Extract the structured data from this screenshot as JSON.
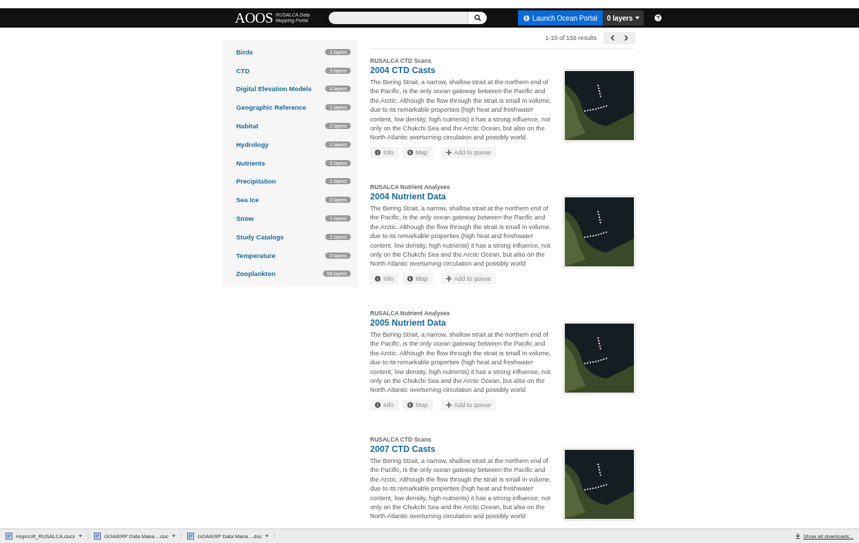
{
  "navbar": {
    "logo": "AOOS",
    "subtitle_1": "RUSALCA Data",
    "subtitle_2": "Mapping Portal",
    "launch_button": "Launch Ocean Portal",
    "layers_button": "0 layers"
  },
  "pagination": {
    "summary": "1-10 of 156 results"
  },
  "categories": [
    {
      "label": "Birds",
      "count": "1 layers"
    },
    {
      "label": "CTD",
      "count": "3 layers"
    },
    {
      "label": "Digital Elevation Models",
      "count": "4 layers"
    },
    {
      "label": "Geographic Reference",
      "count": "1 layers"
    },
    {
      "label": "Habitat",
      "count": "2 layers"
    },
    {
      "label": "Hydrology",
      "count": "1 layers"
    },
    {
      "label": "Nutrients",
      "count": "5 layers"
    },
    {
      "label": "Precipitation",
      "count": "1 layers"
    },
    {
      "label": "Sea Ice",
      "count": "3 layers"
    },
    {
      "label": "Snow",
      "count": "1 layers"
    },
    {
      "label": "Study Catalogs",
      "count": "2 layers"
    },
    {
      "label": "Temperature",
      "count": "3 layers"
    },
    {
      "label": "Zooplankton",
      "count": "58 layers"
    }
  ],
  "results": [
    {
      "source": "RUSALCA CTD Scans",
      "title": "2004 CTD Casts",
      "description": "The Bering Strait, a narrow, shallow strait at the northern end of the Pacific, is the only ocean gateway between the Pacific and the Arctic. Although the flow through the strait is small in volume, due to its remarkable properties (high heat and freshwater content, low density, high nutrients) it has a strong influence, not only on the Chukchi Sea and the Arctic Ocean, but also on the North Atlantic overturning circulation and possibly world",
      "buttons": [
        "Info",
        "Map",
        "Add to queue"
      ]
    },
    {
      "source": "RUSALCA Nutrient Analyses",
      "title": "2004 Nutrient Data",
      "description": "The Bering Strait, a narrow, shallow strait at the northern end of the Pacific, is the only ocean gateway between the Pacific and the Arctic. Although the flow through the strait is small in volume, due to its remarkable properties (high heat and freshwater content, low density, high nutrients) it has a strong influence, not only on the Chukchi Sea and the Arctic Ocean, but also on the North Atlantic overturning circulation and possibly world",
      "buttons": [
        "Info",
        "Map",
        "Add to queue"
      ]
    },
    {
      "source": "RUSALCA Nutrient Analyses",
      "title": "2005 Nutrient Data",
      "description": "The Bering Strait, a narrow, shallow strait at the northern end of the Pacific, is the only ocean gateway between the Pacific and the Arctic. Although the flow through the strait is small in volume, due to its remarkable properties (high heat and freshwater content, low density, high nutrients) it has a strong influence, not only on the Chukchi Sea and the Arctic Ocean, but also on the North Atlantic overturning circulation and possibly world",
      "buttons": [
        "Info",
        "Map",
        "Add to queue"
      ]
    },
    {
      "source": "RUSALCA CTD Scans",
      "title": "2007 CTD Casts",
      "description": "The Bering Strait, a narrow, shallow strait at the northern end of the Pacific, is the only ocean gateway between the Pacific and the Arctic. Although the flow through the strait is small in volume, due to its remarkable properties (high heat and freshwater content, low density, high nutrients) it has a strong influence, not only on the Chukchi Sea and the Arctic Ocean, but also on the North Atlantic overturning circulation and possibly world"
    }
  ],
  "downloads_bar": {
    "files": [
      "Hopcroft_RUSALCA.docx",
      "GOAIERP Data Mana....doc",
      "GOAIERP Data Mana....doc"
    ],
    "show_all": "Show all downloads..."
  }
}
